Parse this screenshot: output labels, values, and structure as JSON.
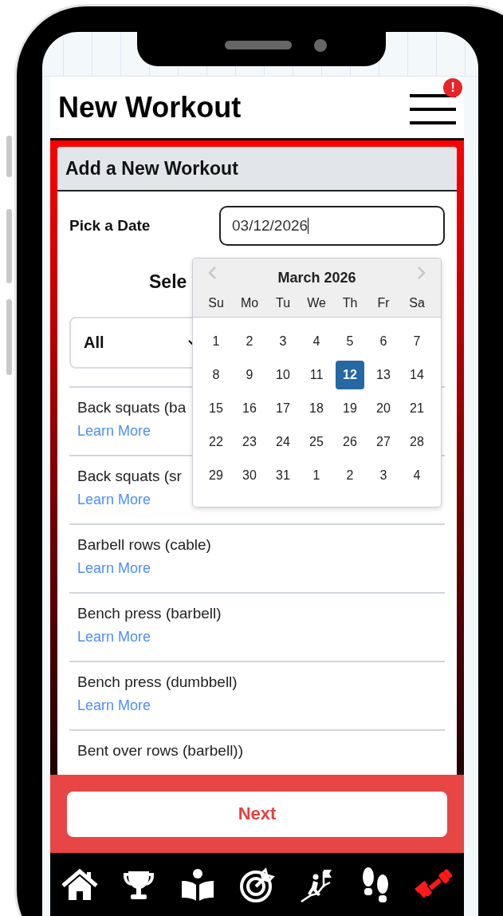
{
  "header": {
    "title": "New Workout",
    "menu_badge": "!"
  },
  "card": {
    "title": "Add a New Workout"
  },
  "date": {
    "label": "Pick a Date",
    "value": "03/12/2026"
  },
  "select_heading": "Sele",
  "filter": {
    "value": "All"
  },
  "exercises": [
    {
      "name": "Back squats (ba",
      "link": "Learn More"
    },
    {
      "name": "Back squats (sr",
      "link": "Learn More"
    },
    {
      "name": "Barbell rows (cable)",
      "link": "Learn More"
    },
    {
      "name": "Bench press (barbell)",
      "link": "Learn More"
    },
    {
      "name": "Bench press (dumbbell)",
      "link": "Learn More"
    },
    {
      "name": "Bent over rows (barbell))"
    }
  ],
  "calendar": {
    "title": "March 2026",
    "weekdays": [
      "Su",
      "Mo",
      "Tu",
      "We",
      "Th",
      "Fr",
      "Sa"
    ],
    "days": [
      {
        "label": "1",
        "selected": false
      },
      {
        "label": "2",
        "selected": false
      },
      {
        "label": "3",
        "selected": false
      },
      {
        "label": "4",
        "selected": false
      },
      {
        "label": "5",
        "selected": false
      },
      {
        "label": "6",
        "selected": false
      },
      {
        "label": "7",
        "selected": false
      },
      {
        "label": "8",
        "selected": false
      },
      {
        "label": "9",
        "selected": false
      },
      {
        "label": "10",
        "selected": false
      },
      {
        "label": "11",
        "selected": false
      },
      {
        "label": "12",
        "selected": true
      },
      {
        "label": "13",
        "selected": false
      },
      {
        "label": "14",
        "selected": false
      },
      {
        "label": "15",
        "selected": false
      },
      {
        "label": "16",
        "selected": false
      },
      {
        "label": "17",
        "selected": false
      },
      {
        "label": "18",
        "selected": false
      },
      {
        "label": "19",
        "selected": false
      },
      {
        "label": "20",
        "selected": false
      },
      {
        "label": "21",
        "selected": false
      },
      {
        "label": "22",
        "selected": false
      },
      {
        "label": "23",
        "selected": false
      },
      {
        "label": "24",
        "selected": false
      },
      {
        "label": "25",
        "selected": false
      },
      {
        "label": "26",
        "selected": false
      },
      {
        "label": "27",
        "selected": false
      },
      {
        "label": "28",
        "selected": false
      },
      {
        "label": "29",
        "selected": false
      },
      {
        "label": "30",
        "selected": false
      },
      {
        "label": "31",
        "selected": false
      },
      {
        "label": "1",
        "selected": false
      },
      {
        "label": "2",
        "selected": false
      },
      {
        "label": "3",
        "selected": false
      },
      {
        "label": "4",
        "selected": false
      }
    ]
  },
  "next_button": "Next",
  "nav": [
    {
      "kind": "home",
      "selected": false
    },
    {
      "kind": "trophy",
      "selected": false
    },
    {
      "kind": "reader",
      "selected": false
    },
    {
      "kind": "target",
      "selected": false
    },
    {
      "kind": "climb",
      "selected": false
    },
    {
      "kind": "footprints",
      "selected": false
    },
    {
      "kind": "dumbbell",
      "selected": true
    }
  ]
}
